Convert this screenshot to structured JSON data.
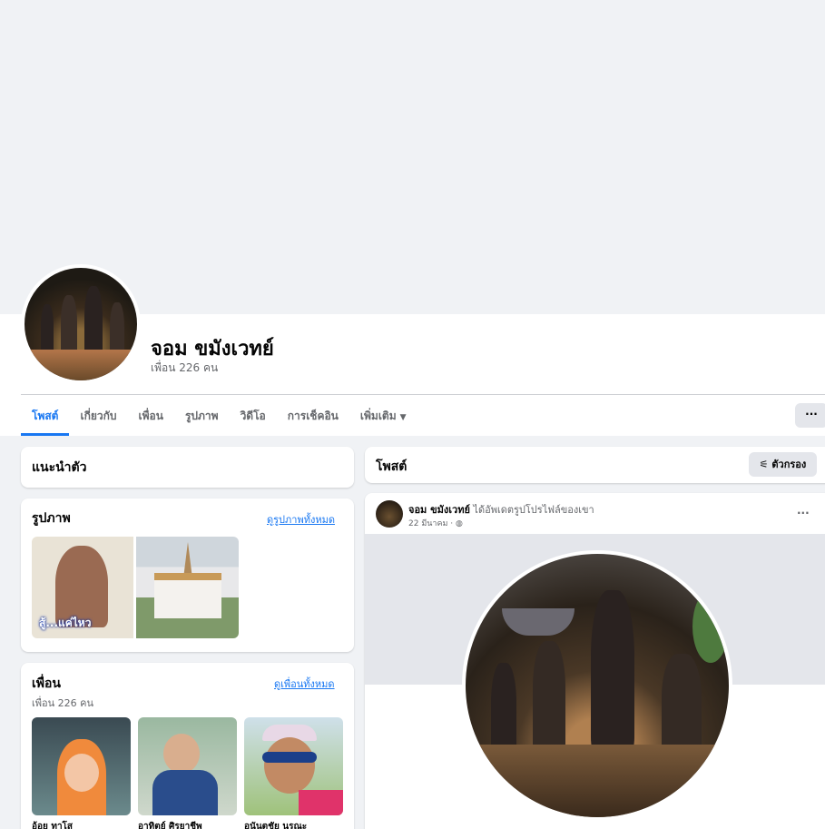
{
  "profile": {
    "name": "จอม ขมังเวทย์",
    "friends_count": "เพื่อน 226 คน"
  },
  "tabs": [
    {
      "label": "โพสต์",
      "active": true
    },
    {
      "label": "เกี่ยวกับ"
    },
    {
      "label": "เพื่อน"
    },
    {
      "label": "รูปภาพ"
    },
    {
      "label": "วิดีโอ"
    },
    {
      "label": "การเช็คอิน"
    },
    {
      "label": "เพิ่มเติม"
    }
  ],
  "more_button": "···",
  "intro": {
    "title": "แนะนำตัว"
  },
  "photos": {
    "title": "รูปภาพ",
    "see_all": "ดูรูปภาพทั้งหมด",
    "caption_text": "สู้...แค่ไหว"
  },
  "friends": {
    "title": "เพื่อน",
    "count": "เพื่อน 226 คน",
    "see_all": "ดูเพื่อนทั้งหมด",
    "list": [
      {
        "name": "อ้อย ทาโส"
      },
      {
        "name": "อาทิตย์ ศิรยาชีพ"
      },
      {
        "name": "อนันตชัย นุรณะ"
      }
    ]
  },
  "posts": {
    "title": "โพสต์",
    "filter_label": "ตัวกรอง",
    "post": {
      "author": "จอม ขมังเวทย์",
      "action": " ได้อัพเดตรูปโปรไฟล์ของเขา",
      "date": "22 มีนาคม ·",
      "menu": "···"
    }
  },
  "colors": {
    "accent": "#1877f2",
    "background": "#f0f2f5"
  }
}
